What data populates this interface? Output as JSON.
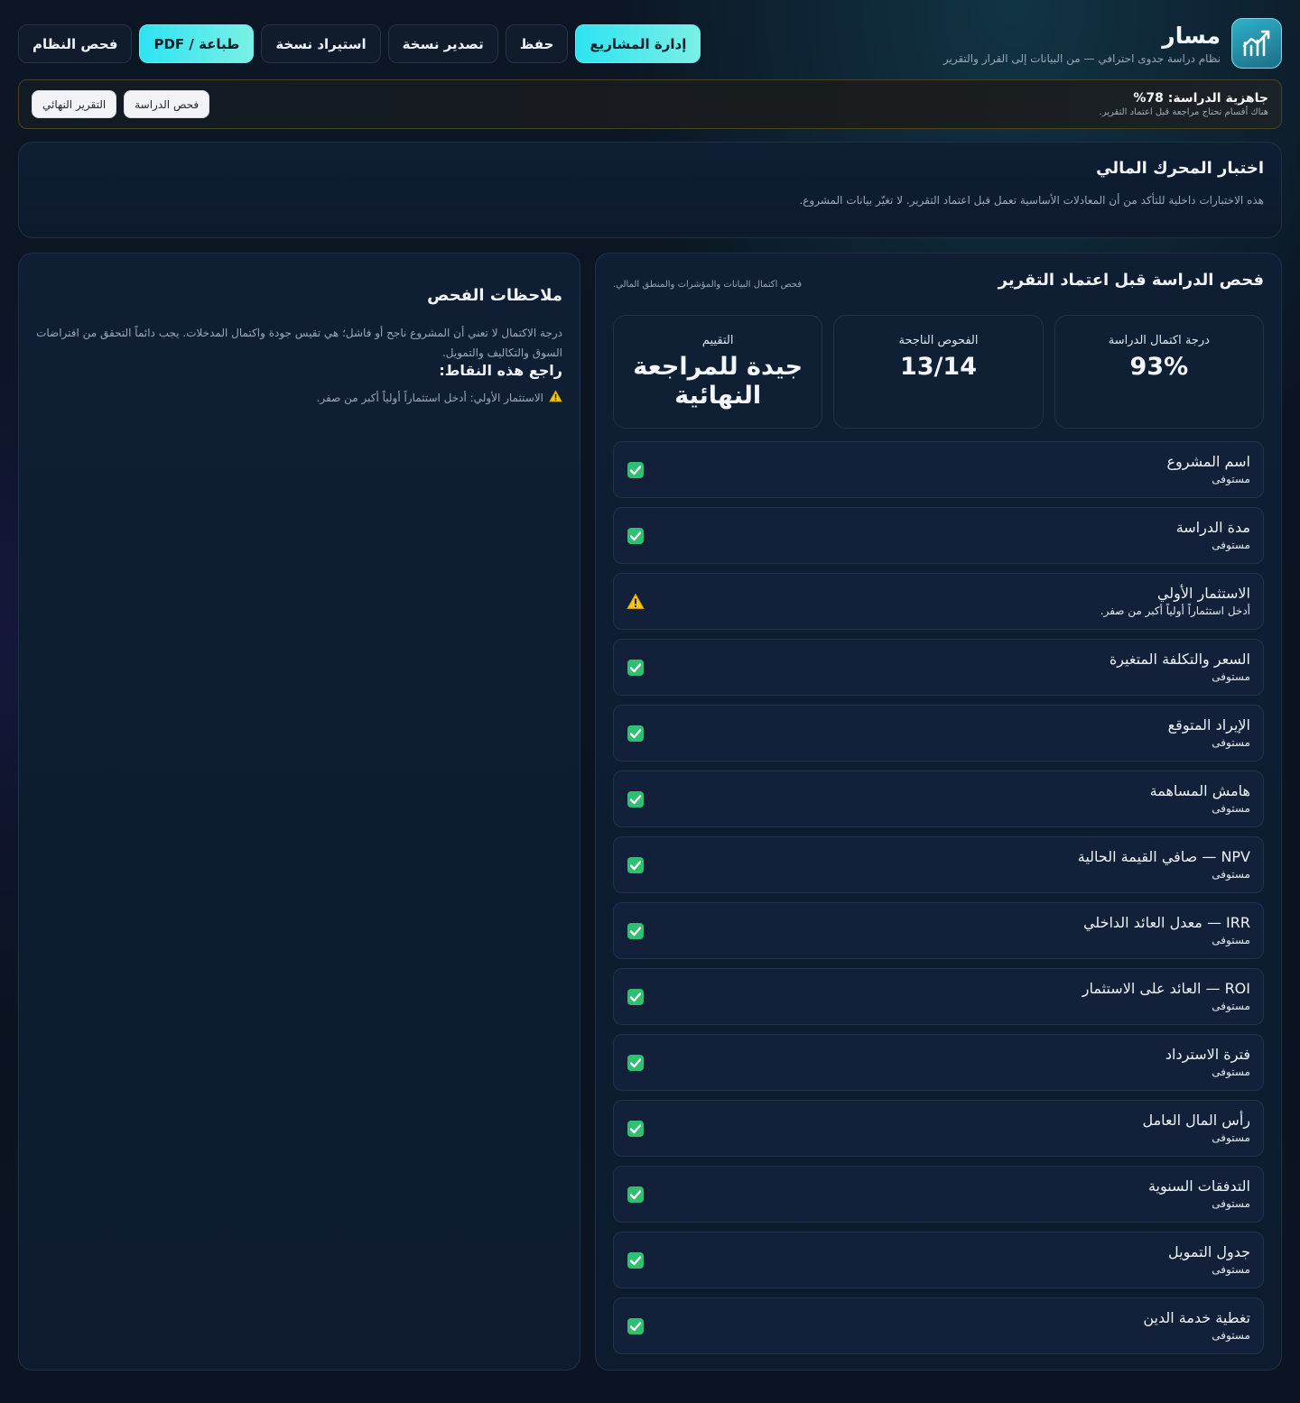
{
  "brand": {
    "title": "مسار",
    "subtitle": "نظام دراسة جدوى احترافي — من البيانات إلى القرار والتقرير",
    "logo_icon": "chart-trend-up-icon"
  },
  "nav": [
    {
      "label": "إدارة المشاريع",
      "primary": true
    },
    {
      "label": "حفظ",
      "primary": false
    },
    {
      "label": "تصدير نسخة",
      "primary": false
    },
    {
      "label": "استيراد نسخة",
      "primary": false
    },
    {
      "label": "طباعة / PDF",
      "primary": true
    },
    {
      "label": "فحص النظام",
      "primary": false
    }
  ],
  "readiness": {
    "title": "جاهزية الدراسة: 78%",
    "subtitle": "هناك أقسام تحتاج مراجعة قبل اعتماد التقرير.",
    "actions": [
      "فحص الدراسة",
      "التقرير النهائي"
    ]
  },
  "engine": {
    "title": "اختبار المحرك المالي",
    "description": "هذه الاختبارات داخلية للتأكد من أن المعادلات الأساسية تعمل قبل اعتماد التقرير. لا تغيّر بيانات المشروع."
  },
  "check": {
    "title": "فحص الدراسة قبل اعتماد التقرير",
    "subtitle": "فحص اكتمال البيانات والمؤشرات والمنطق المالي.",
    "stats": [
      {
        "label": "درجة اكتمال الدراسة",
        "value": "93%"
      },
      {
        "label": "الفحوص الناجحة",
        "value": "13/14"
      },
      {
        "label": "التقييم",
        "value": "جيدة للمراجعة النهائية"
      }
    ],
    "items": [
      {
        "name": "اسم المشروع",
        "status": "مستوفى",
        "ok": true
      },
      {
        "name": "مدة الدراسة",
        "status": "مستوفى",
        "ok": true
      },
      {
        "name": "الاستثمار الأولي",
        "status": "أدخل استثماراً أولياً أكبر من صفر.",
        "ok": false
      },
      {
        "name": "السعر والتكلفة المتغيرة",
        "status": "مستوفى",
        "ok": true
      },
      {
        "name": "الإيراد المتوقع",
        "status": "مستوفى",
        "ok": true
      },
      {
        "name": "هامش المساهمة",
        "status": "مستوفى",
        "ok": true
      },
      {
        "name": "NPV — صافي القيمة الحالية",
        "status": "مستوفى",
        "ok": true
      },
      {
        "name": "IRR — معدل العائد الداخلي",
        "status": "مستوفى",
        "ok": true
      },
      {
        "name": "ROI — العائد على الاستثمار",
        "status": "مستوفى",
        "ok": true
      },
      {
        "name": "فترة الاسترداد",
        "status": "مستوفى",
        "ok": true
      },
      {
        "name": "رأس المال العامل",
        "status": "مستوفى",
        "ok": true
      },
      {
        "name": "التدفقات السنوية",
        "status": "مستوفى",
        "ok": true
      },
      {
        "name": "جدول التمويل",
        "status": "مستوفى",
        "ok": true
      },
      {
        "name": "تغطية خدمة الدين",
        "status": "مستوفى",
        "ok": true
      }
    ]
  },
  "notes": {
    "title": "ملاحظات الفحص",
    "description": "درجة الاكتمال لا تعني أن المشروع ناجح أو فاشل؛ هي تقيس جودة واكتمال المدخلات. يجب دائماً التحقق من افتراضات السوق والتكاليف والتمويل.",
    "review_title": "راجع هذه النقاط:",
    "review_items": [
      "الاستثمار الأولي: أدخل استثماراً أولياً أكبر من صفر."
    ]
  },
  "colors": {
    "accent": "#2ee3f2",
    "ok": "#2fbf71",
    "warn": "#f5c518"
  }
}
